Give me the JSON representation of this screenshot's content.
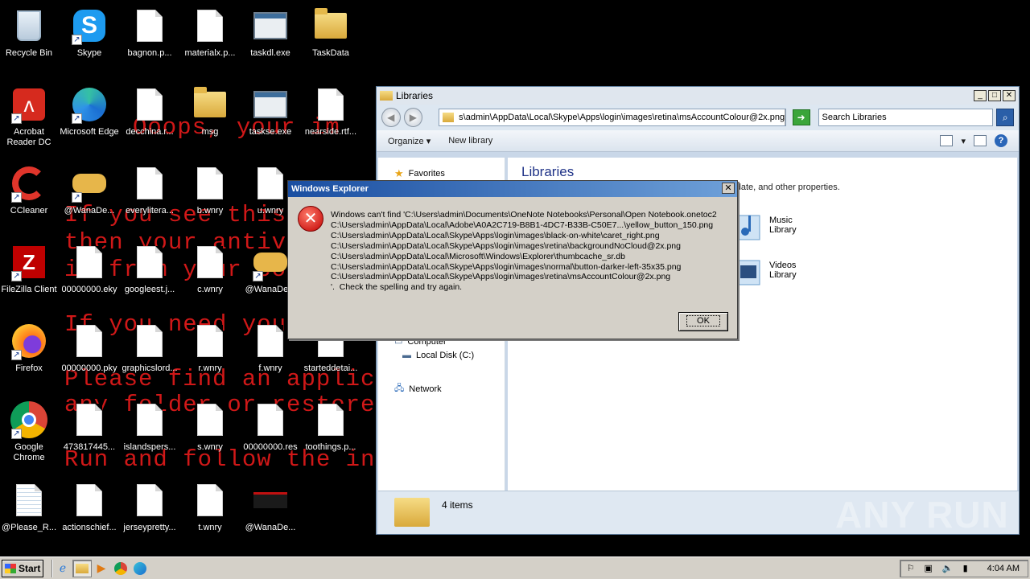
{
  "desktop": {
    "ransom_lines": [
      "Ooops, your im",
      "If you see this",
      "then your antivi",
      "it from your com",
      "If you need your",
      "Please find an applica",
      "any folder or restore",
      "Run and follow the ins"
    ],
    "icons": [
      {
        "label": "Recycle Bin",
        "type": "recycle"
      },
      {
        "label": "Skype",
        "type": "skype"
      },
      {
        "label": "bagnon.p...",
        "type": "doc"
      },
      {
        "label": "materialx.p...",
        "type": "doc"
      },
      {
        "label": "taskdl.exe",
        "type": "exe"
      },
      {
        "label": "TaskData",
        "type": "folder"
      },
      {
        "label": "Acrobat Reader DC",
        "type": "acrobat"
      },
      {
        "label": "Microsoft Edge",
        "type": "edge"
      },
      {
        "label": "decchina.r...",
        "type": "doc"
      },
      {
        "label": "msg",
        "type": "folder"
      },
      {
        "label": "taskse.exe",
        "type": "exe"
      },
      {
        "label": "nearside.rtf...",
        "type": "doc"
      },
      {
        "label": "CCleaner",
        "type": "ccleaner"
      },
      {
        "label": "@WanaDe...",
        "type": "wana"
      },
      {
        "label": "everylitera...",
        "type": "doc"
      },
      {
        "label": "b.wnry",
        "type": "doc"
      },
      {
        "label": "u.wnry",
        "type": "doc"
      },
      {
        "label": "FileZilla Client",
        "type": "filezilla"
      },
      {
        "label": "00000000.eky",
        "type": "doc"
      },
      {
        "label": "googleest.j...",
        "type": "doc"
      },
      {
        "label": "c.wnry",
        "type": "doc"
      },
      {
        "label": "@WanaDe...",
        "type": "wana"
      },
      {
        "label": "Firefox",
        "type": "firefox"
      },
      {
        "label": "00000000.pky",
        "type": "doc"
      },
      {
        "label": "graphicslord...",
        "type": "doc"
      },
      {
        "label": "r.wnry",
        "type": "doc"
      },
      {
        "label": "f.wnry",
        "type": "doc"
      },
      {
        "label": "starteddetai...",
        "type": "doc"
      },
      {
        "label": "Google Chrome",
        "type": "chrome"
      },
      {
        "label": "473817445...",
        "type": "doc"
      },
      {
        "label": "islandspers...",
        "type": "doc"
      },
      {
        "label": "s.wnry",
        "type": "doc"
      },
      {
        "label": "00000000.res",
        "type": "doc"
      },
      {
        "label": "toothings.p...",
        "type": "doc"
      },
      {
        "label": "@Please_R...",
        "type": "notepad"
      },
      {
        "label": "actionschief...",
        "type": "doc"
      },
      {
        "label": "jerseypretty...",
        "type": "doc"
      },
      {
        "label": "t.wnry",
        "type": "doc"
      },
      {
        "label": "@WanaDe...",
        "type": "wanadec"
      }
    ]
  },
  "explorer": {
    "title": "Libraries",
    "address": "s\\admin\\AppData\\Local\\Skype\\Apps\\login\\images\\retina\\msAccountColour@2x.png",
    "search_placeholder": "Search Libraries",
    "toolbar": {
      "organize": "Organize",
      "new_library": "New library"
    },
    "nav": {
      "favorites": "Favorites",
      "computer": "Computer",
      "local_disk": "Local Disk (C:)",
      "network": "Network"
    },
    "content_title": "Libraries",
    "content_sub": "ler, date, and other properties.",
    "libraries": [
      {
        "name": "Music",
        "sub": "Library"
      },
      {
        "name": "Videos",
        "sub": "Library"
      }
    ],
    "details_count": "4 items"
  },
  "dialog": {
    "title": "Windows Explorer",
    "message": "Windows can't find 'C:\\Users\\admin\\Documents\\OneNote Notebooks\\Personal\\Open Notebook.onetoc2\nC:\\Users\\admin\\AppData\\Local\\Adobe\\A0A2C719-B8B1-4DC7-B33B-C50E7...\\yellow_button_150.png\nC:\\Users\\admin\\AppData\\Local\\Skype\\Apps\\login\\images\\black-on-white\\caret_right.png\nC:\\Users\\admin\\AppData\\Local\\Skype\\Apps\\login\\images\\retina\\backgroundNoCloud@2x.png\nC:\\Users\\admin\\AppData\\Local\\Microsoft\\Windows\\Explorer\\thumbcache_sr.db\nC:\\Users\\admin\\AppData\\Local\\Skype\\Apps\\login\\images\\normal\\button-darker-left-35x35.png\nC:\\Users\\admin\\AppData\\Local\\Skype\\Apps\\login\\images\\retina\\msAccountColour@2x.png\n'.  Check the spelling and try again.",
    "ok": "OK"
  },
  "taskbar": {
    "start": "Start",
    "clock": "4:04 AM"
  },
  "watermark": "ANY RUN"
}
